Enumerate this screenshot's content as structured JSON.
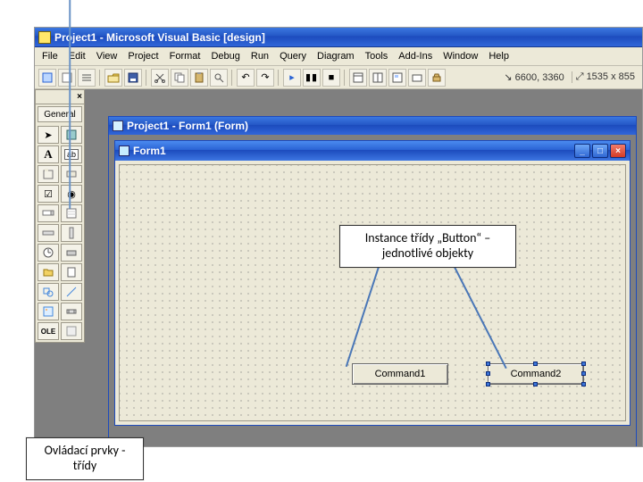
{
  "app": {
    "title": "Project1 - Microsoft Visual Basic [design]"
  },
  "menu": {
    "items": [
      "File",
      "Edit",
      "View",
      "Project",
      "Format",
      "Debug",
      "Run",
      "Query",
      "Diagram",
      "Tools",
      "Add-Ins",
      "Window",
      "Help"
    ]
  },
  "toolbar": {
    "pos": "6600, 3360",
    "size": "1535 x 855"
  },
  "toolbox": {
    "title": "General"
  },
  "mdi": {
    "title": "Project1 - Form1 (Form)"
  },
  "form": {
    "title": "Form1",
    "buttons": {
      "command1": "Command1",
      "command2": "Command2"
    }
  },
  "callout": {
    "instances_line1": "Instance třídy „Button“ –",
    "instances_line2": "jednotlivé objekty",
    "toolbox_line1": "Ovládací prvky -",
    "toolbox_line2": "třídy"
  }
}
